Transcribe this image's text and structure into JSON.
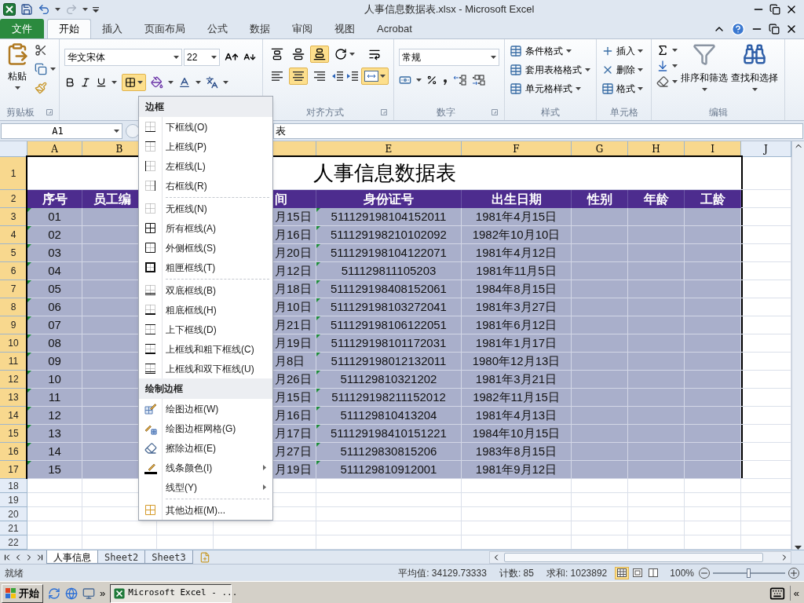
{
  "window": {
    "title": "人事信息数据表.xlsx - Microsoft Excel"
  },
  "file_tab": {
    "label": "文件"
  },
  "tabs": [
    {
      "label": "开始",
      "selected": true
    },
    {
      "label": "插入",
      "selected": false
    },
    {
      "label": "页面布局",
      "selected": false
    },
    {
      "label": "公式",
      "selected": false
    },
    {
      "label": "数据",
      "selected": false
    },
    {
      "label": "审阅",
      "selected": false
    },
    {
      "label": "视图",
      "selected": false
    },
    {
      "label": "Acrobat",
      "selected": false
    }
  ],
  "ribbon": {
    "clipboard": {
      "paste": "粘贴",
      "label": "剪贴板"
    },
    "font": {
      "name": "华文宋体",
      "size": "22",
      "border_selected": true
    },
    "alignment": {
      "label": "对齐方式",
      "vertical": [
        {
          "selected": false
        },
        {
          "selected": false
        },
        {
          "selected": true
        }
      ],
      "horizontal": [
        {
          "selected": false
        },
        {
          "selected": true
        },
        {
          "selected": false
        }
      ],
      "merge_selected": true
    },
    "number": {
      "format": "常规",
      "label": "数字"
    },
    "styles": {
      "label": "样式",
      "items": [
        "条件格式",
        "套用表格格式",
        "单元格样式"
      ]
    },
    "cells": {
      "label": "单元格",
      "items": [
        "插入",
        "删除",
        "格式"
      ]
    },
    "editing": {
      "label": "编辑",
      "items": [
        "排序和筛选",
        "查找和选择"
      ]
    }
  },
  "formula_bar": {
    "name_box": "A1",
    "formula": "表"
  },
  "columns": [
    {
      "letter": "A"
    },
    {
      "letter": "B"
    },
    {},
    {},
    {
      "letter": "E"
    },
    {
      "letter": "F"
    },
    {
      "letter": "G"
    },
    {
      "letter": "H"
    },
    {
      "letter": "I"
    },
    {
      "letter": "J"
    }
  ],
  "title_row": {
    "number": "1",
    "title": "人事信息数据表"
  },
  "header_row": {
    "number": "2",
    "cells": [
      {
        "text": "序号"
      },
      {
        "text": "员工编"
      },
      {},
      {
        "text": "间"
      },
      {
        "text": "身份证号"
      },
      {
        "text": "出生日期"
      },
      {
        "text": "性别"
      },
      {
        "text": "年龄"
      },
      {
        "text": "工龄"
      }
    ]
  },
  "rows": [
    {
      "number": "3",
      "seq": "01",
      "column_d": "月15日",
      "id_number": "511129198104152011",
      "birth_date": "1981年4月15日"
    },
    {
      "number": "4",
      "seq": "02",
      "column_d": "月16日",
      "id_number": "511129198210102092",
      "birth_date": "1982年10月10日"
    },
    {
      "number": "5",
      "seq": "03",
      "column_d": "月20日",
      "id_number": "511129198104122071",
      "birth_date": "1981年4月12日"
    },
    {
      "number": "6",
      "seq": "04",
      "column_d": "月12日",
      "id_number": "511129811105203",
      "birth_date": "1981年11月5日"
    },
    {
      "number": "7",
      "seq": "05",
      "column_d": "月18日",
      "id_number": "511129198408152061",
      "birth_date": "1984年8月15日"
    },
    {
      "number": "8",
      "seq": "06",
      "column_d": "月10日",
      "id_number": "511129198103272041",
      "birth_date": "1981年3月27日"
    },
    {
      "number": "9",
      "seq": "07",
      "column_d": "月21日",
      "id_number": "511129198106122051",
      "birth_date": "1981年6月12日"
    },
    {
      "number": "10",
      "seq": "08",
      "column_d": "月19日",
      "id_number": "511129198101172031",
      "birth_date": "1981年1月17日"
    },
    {
      "number": "11",
      "seq": "09",
      "column_d": "月8日",
      "id_number": "511129198012132011",
      "birth_date": "1980年12月13日"
    },
    {
      "number": "12",
      "seq": "10",
      "column_d": "月26日",
      "id_number": "511129810321202",
      "birth_date": "1981年3月21日"
    },
    {
      "number": "13",
      "seq": "11",
      "column_d": "月15日",
      "id_number": "511129198211152012",
      "birth_date": "1982年11月15日"
    },
    {
      "number": "14",
      "seq": "12",
      "column_d": "月16日",
      "id_number": "511129810413204",
      "birth_date": "1981年4月13日"
    },
    {
      "number": "15",
      "seq": "13",
      "column_d": "月17日",
      "id_number": "511129198410151221",
      "birth_date": "1984年10月15日"
    },
    {
      "number": "16",
      "seq": "14",
      "column_d": "月27日",
      "id_number": "511129830815206",
      "birth_date": "1983年8月15日"
    },
    {
      "number": "17",
      "seq": "15",
      "column_d": "月19日",
      "id_number": "511129810912001",
      "birth_date": "1981年9月12日"
    }
  ],
  "empty_rows": [
    "18",
    "19",
    "20",
    "21",
    "22"
  ],
  "border_menu": {
    "sections": [
      {
        "title": "边框",
        "items": [
          {
            "label": "下框线(O)",
            "kind": "bottom"
          },
          {
            "label": "上框线(P)",
            "kind": "top"
          },
          {
            "label": "左框线(L)",
            "kind": "left"
          },
          {
            "label": "右框线(R)",
            "kind": "right"
          },
          {
            "label": "无框线(N)",
            "kind": "none",
            "separator_before": true
          },
          {
            "label": "所有框线(A)",
            "kind": "all"
          },
          {
            "label": "外侧框线(S)",
            "kind": "outside"
          },
          {
            "label": "粗匣框线(T)",
            "kind": "thick_box"
          },
          {
            "label": "双底框线(B)",
            "kind": "double_bottom",
            "separator_before": true
          },
          {
            "label": "粗底框线(H)",
            "kind": "thick_bottom"
          },
          {
            "label": "上下框线(D)",
            "kind": "top_bottom"
          },
          {
            "label": "上框线和粗下框线(C)",
            "kind": "top_thick_bottom"
          },
          {
            "label": "上框线和双下框线(U)",
            "kind": "top_double_bottom"
          }
        ]
      },
      {
        "title": "绘制边框",
        "items": [
          {
            "label": "绘图边框(W)",
            "kind": "draw"
          },
          {
            "label": "绘图边框网格(G)",
            "kind": "draw_grid"
          },
          {
            "label": "擦除边框(E)",
            "kind": "eraser"
          },
          {
            "label": "线条颜色(I)",
            "kind": "line_color",
            "submenu": true
          },
          {
            "label": "线型(Y)",
            "kind": "line_style",
            "submenu": true
          },
          {
            "label": "其他边框(M)...",
            "kind": "more",
            "separator_before": true
          }
        ]
      }
    ]
  },
  "sheet_tabs": [
    {
      "label": "人事信息",
      "selected": true
    },
    {
      "label": "Sheet2",
      "selected": false
    },
    {
      "label": "Sheet3",
      "selected": false
    }
  ],
  "status_bar": {
    "ready": "就绪",
    "average": "平均值: 34129.73333",
    "count": "计数: 85",
    "sum": "求和: 1023892",
    "views": [
      {
        "selected": true
      },
      {
        "selected": false
      },
      {
        "selected": false
      }
    ],
    "zoom": "100%",
    "zoom_slider": {
      "level": 0.5
    }
  },
  "taskbar": {
    "start": "开始",
    "more": "»",
    "task": "Microsoft Excel - ...",
    "tray_more": "«"
  }
}
